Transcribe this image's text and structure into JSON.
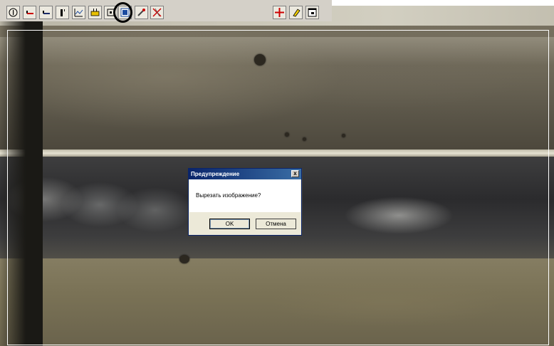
{
  "toolbar": {
    "buttons": [
      {
        "icon": "info-icon"
      },
      {
        "icon": "line-red-icon"
      },
      {
        "icon": "line-dark-icon"
      },
      {
        "icon": "text-cursor-icon"
      },
      {
        "icon": "graph-icon"
      },
      {
        "icon": "ruler-icon"
      },
      {
        "icon": "grid-icon"
      },
      {
        "icon": "crop-image-icon"
      },
      {
        "icon": "brush-icon"
      },
      {
        "icon": "cross-out-icon"
      }
    ],
    "right_buttons": [
      {
        "icon": "crosshair-icon"
      },
      {
        "icon": "eraser-icon"
      },
      {
        "icon": "window-icon"
      }
    ],
    "highlighted_button": "crop-image-icon"
  },
  "dialog": {
    "title": "Предупреждение",
    "close_label": "x",
    "message": "Вырезать изображение?",
    "ok_label": "OK",
    "cancel_label": "Отмена"
  },
  "colors": {
    "toolbar_bg": "#d4d0c8",
    "title_bar": "#0a246a",
    "accent_red": "#cc0000"
  }
}
